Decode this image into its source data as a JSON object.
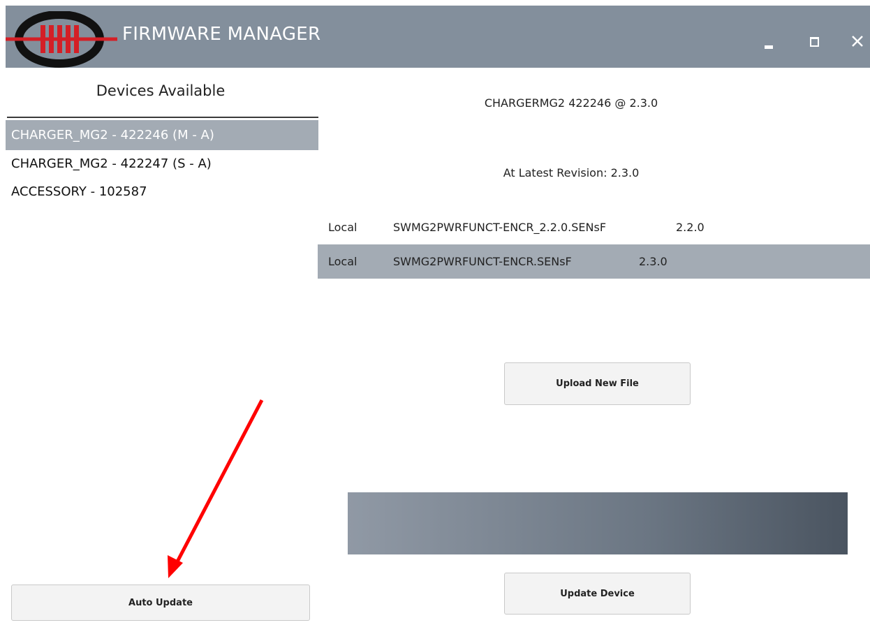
{
  "app": {
    "title": "FIRMWARE MANAGER",
    "accent_color": "#d41f26",
    "titlebar_color": "#838f9c",
    "selection_color": "#a3abb4"
  },
  "window_controls": {
    "minimize_icon": "minimize-icon",
    "maximize_icon": "maximize-icon",
    "close_icon": "close-icon"
  },
  "devices_panel": {
    "title": "Devices Available",
    "items": [
      {
        "label": "CHARGER_MG2 - 422246 (M - A)",
        "selected": true
      },
      {
        "label": "CHARGER_MG2 - 422247 (S - A)",
        "selected": false
      },
      {
        "label": "ACCESSORY - 102587",
        "selected": false
      }
    ]
  },
  "detail": {
    "device_header": "CHARGERMG2 422246 @ 2.3.0",
    "revision_status": "At Latest Revision: 2.3.0",
    "files": [
      {
        "source": "Local",
        "name": "SWMG2PWRFUNCT-ENCR_2.2.0.SENsF",
        "version": "2.2.0",
        "selected": false
      },
      {
        "source": "Local",
        "name": "SWMG2PWRFUNCT-ENCR.SENsF",
        "version": "2.3.0",
        "selected": true
      }
    ]
  },
  "buttons": {
    "upload": "Upload New File",
    "update": "Update Device",
    "auto": "Auto Update"
  },
  "progress": {
    "value": 1.0
  },
  "annotation": {
    "type": "arrow",
    "color": "#ff0000",
    "points_to": "auto-update-button"
  }
}
